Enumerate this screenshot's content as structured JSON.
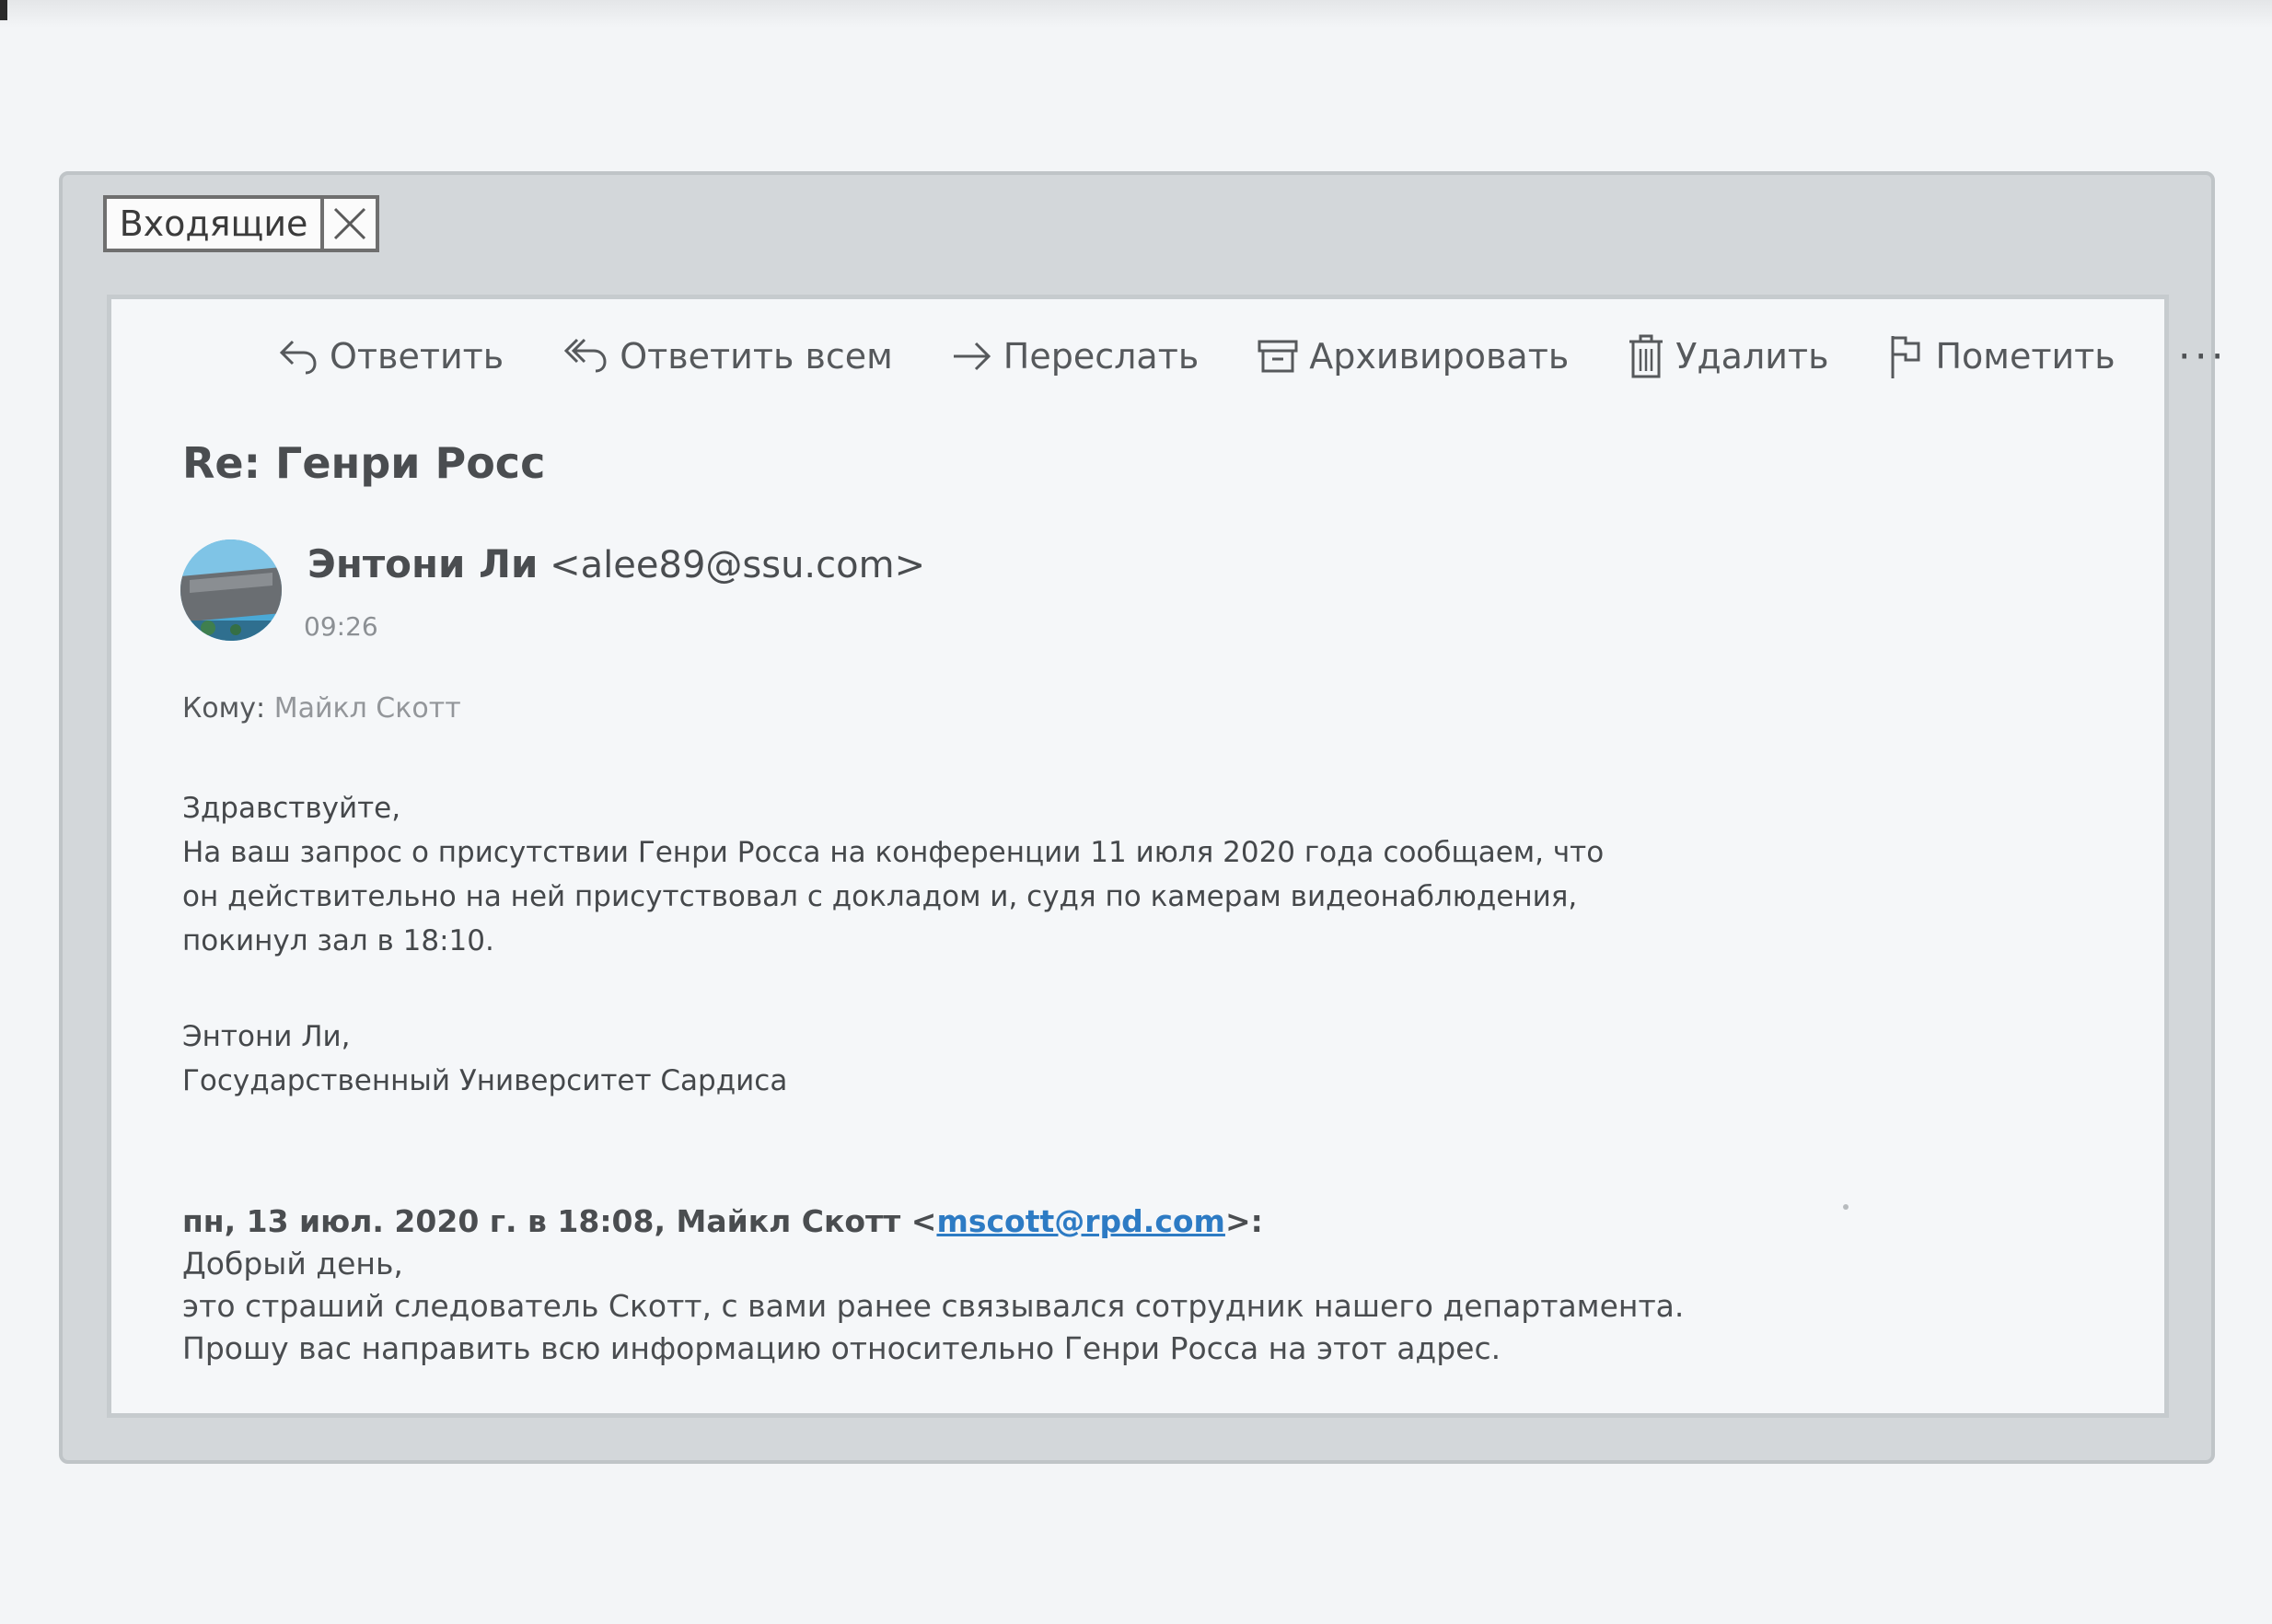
{
  "tab": {
    "label": "Входящие"
  },
  "toolbar": {
    "reply": "Ответить",
    "reply_all": "Ответить всем",
    "forward": "Переслать",
    "archive": "Архивировать",
    "delete": "Удалить",
    "flag": "Пометить",
    "more": "···"
  },
  "message": {
    "subject": "Re: Генри Росс",
    "sender_name": "Энтони Ли",
    "sender_email": "<alee89@ssu.com>",
    "time": "09:26",
    "to_label": "Кому:",
    "to_value": "Майкл Скотт",
    "greeting": "Здравствуйте,",
    "body_lines": [
      "На ваш запрос о присутствии Генри Росса на конференции 11 июля 2020 года сообщаем, что",
      "он действительно на ней присутствовал с докладом и, судя по камерам видеонаблюдения,",
      "покинул зал в 18:10."
    ],
    "signature_lines": [
      "Энтони Ли,",
      "Государственный Университет Сардиса"
    ]
  },
  "quoted": {
    "header_prefix": "пн, 13 июл. 2020 г. в 18:08, Майкл Скотт <",
    "header_email": "mscott@rpd.com",
    "header_suffix": ">:",
    "lines": [
      "Добрый день,",
      "это страший следователь Скотт, с вами ранее связывался сотрудник нашего департамента.",
      "Прошу вас направить всю информацию относительно Генри Росса на этот адрес."
    ]
  },
  "icons": {
    "reply": "reply-arrow-icon",
    "reply_all": "reply-all-icon",
    "forward": "forward-arrow-icon",
    "archive": "archive-box-icon",
    "delete": "trash-icon",
    "flag": "flag-icon",
    "close": "close-x-icon"
  },
  "colors": {
    "link": "#2d7bc4",
    "frame": "#d3d7da",
    "card": "#f5f7f9"
  }
}
